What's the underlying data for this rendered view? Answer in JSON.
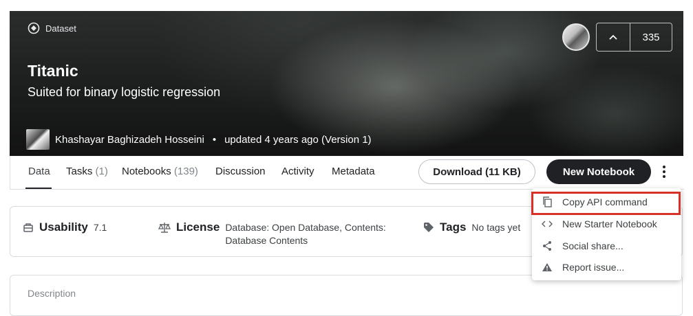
{
  "header": {
    "badge": "Dataset",
    "title": "Titanic",
    "subtitle": "Suited for binary logistic regression",
    "author": "Khashayar Baghizadeh Hosseini",
    "separator": "•",
    "updated": "updated 4 years ago (Version 1)",
    "vote_count": "335"
  },
  "tabs": [
    {
      "label": "Data",
      "count": ""
    },
    {
      "label": "Tasks",
      "count": "(1)"
    },
    {
      "label": "Notebooks",
      "count": "(139)"
    },
    {
      "label": "Discussion",
      "count": ""
    },
    {
      "label": "Activity",
      "count": ""
    },
    {
      "label": "Metadata",
      "count": ""
    }
  ],
  "actions": {
    "download": "Download (11 KB)",
    "new_notebook": "New Notebook"
  },
  "info": {
    "usability_label": "Usability",
    "usability_value": "7.1",
    "license_label": "License",
    "license_value": "Database: Open Database, Contents: Database Contents",
    "tags_label": "Tags",
    "tags_value": "No tags yet"
  },
  "description_label": "Description",
  "menu": {
    "items": [
      {
        "label": "Copy API command",
        "icon": "copy-icon"
      },
      {
        "label": "New Starter Notebook",
        "icon": "code-icon"
      },
      {
        "label": "Social share...",
        "icon": "share-icon"
      },
      {
        "label": "Report issue...",
        "icon": "warning-icon"
      }
    ],
    "highlight_color": "#d93025"
  }
}
